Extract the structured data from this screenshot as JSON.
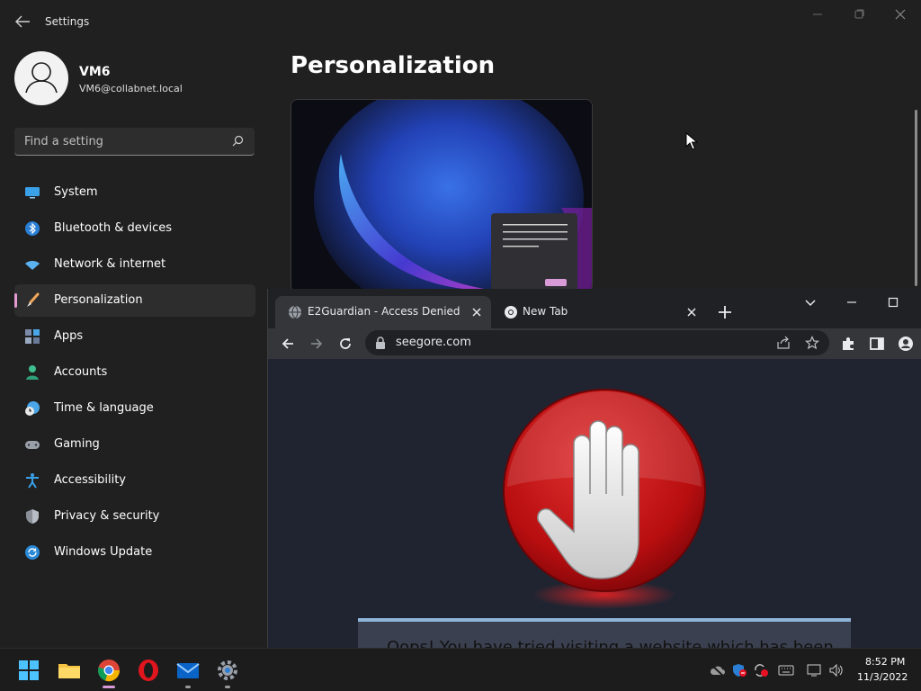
{
  "settings": {
    "title": "Settings",
    "profile": {
      "name": "VM6",
      "email": "VM6@collabnet.local"
    },
    "search": {
      "placeholder": "Find a setting"
    },
    "nav": [
      {
        "label": "System",
        "icon": "monitor-icon"
      },
      {
        "label": "Bluetooth & devices",
        "icon": "bluetooth-icon"
      },
      {
        "label": "Network & internet",
        "icon": "wifi-icon"
      },
      {
        "label": "Personalization",
        "icon": "brush-icon",
        "active": true
      },
      {
        "label": "Apps",
        "icon": "apps-icon"
      },
      {
        "label": "Accounts",
        "icon": "person-icon"
      },
      {
        "label": "Time & language",
        "icon": "clock-globe-icon"
      },
      {
        "label": "Gaming",
        "icon": "gamepad-icon"
      },
      {
        "label": "Accessibility",
        "icon": "accessibility-icon"
      },
      {
        "label": "Privacy & security",
        "icon": "shield-icon"
      },
      {
        "label": "Windows Update",
        "icon": "update-icon"
      }
    ],
    "page_title": "Personalization",
    "accent_color": "#e39ad0"
  },
  "browser": {
    "tabs": [
      {
        "title": "E2Guardian - Access Denied",
        "active": true
      },
      {
        "title": "New Tab",
        "active": false
      }
    ],
    "url": "seegore.com",
    "message": "Oops! You have tried visiting a website which has been"
  },
  "taskbar": {
    "apps": [
      "windows-start-icon",
      "file-explorer-icon",
      "chrome-icon",
      "opera-icon",
      "mail-icon",
      "settings-gear-icon"
    ],
    "clock": {
      "time": "8:52 PM",
      "date": "11/3/2022"
    }
  }
}
